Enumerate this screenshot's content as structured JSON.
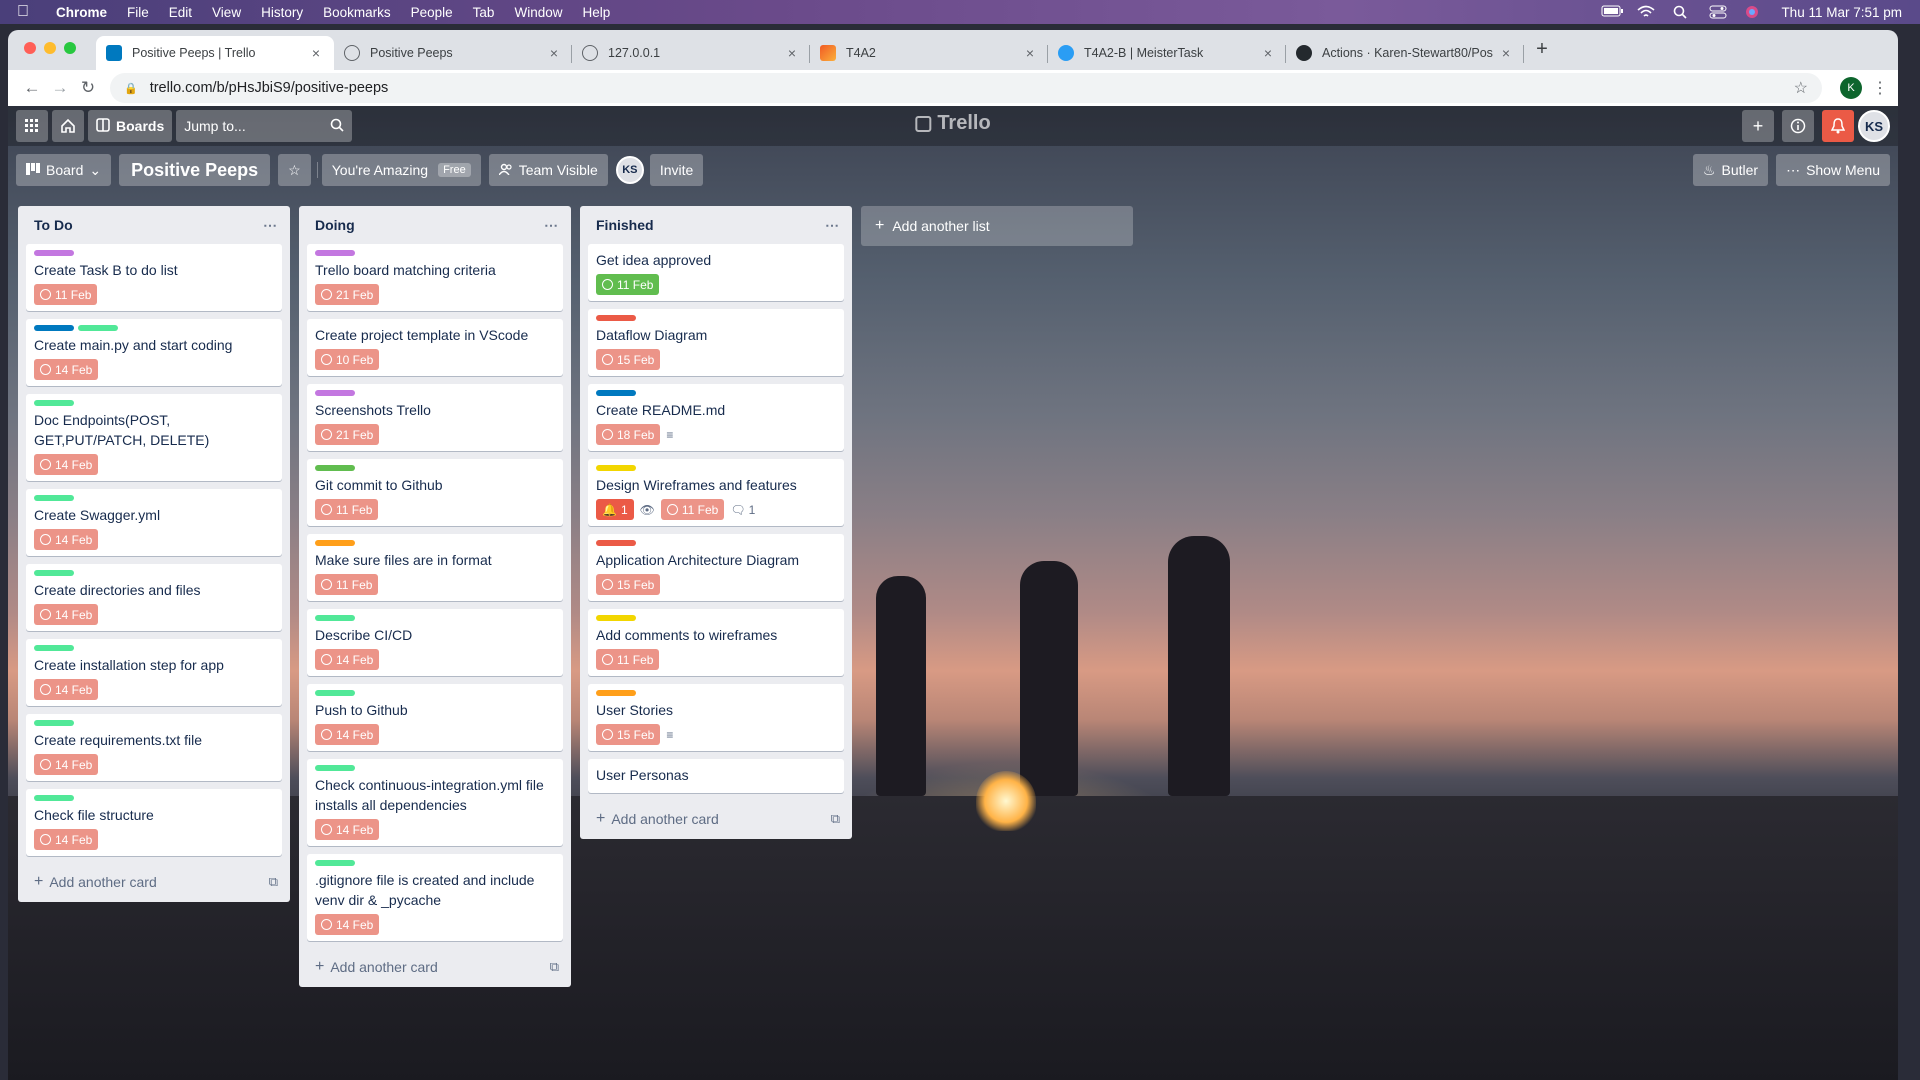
{
  "os_menubar": {
    "app": "Chrome",
    "items": [
      "File",
      "Edit",
      "View",
      "History",
      "Bookmarks",
      "People",
      "Tab",
      "Window",
      "Help"
    ],
    "clock": "Thu 11 Mar  7:51 pm"
  },
  "browser": {
    "tabs": [
      {
        "title": "Positive Peeps | Trello",
        "favicon": "trello-icon",
        "active": true
      },
      {
        "title": "Positive Peeps",
        "favicon": "globe-icon"
      },
      {
        "title": "127.0.0.1",
        "favicon": "globe-icon"
      },
      {
        "title": "T4A2",
        "favicon": "app-icon"
      },
      {
        "title": "T4A2-B | MeisterTask",
        "favicon": "check-icon"
      },
      {
        "title": "Actions · Karen-Stewart80/Pos",
        "favicon": "github-icon"
      }
    ],
    "url": "trello.com/b/pHsJbiS9/positive-peeps",
    "profile_initial": "K"
  },
  "trello_nav": {
    "boards_label": "Boards",
    "jump_placeholder": "Jump to...",
    "logo": "Trello",
    "avatar": "KS"
  },
  "board_header": {
    "view": "Board",
    "title": "Positive Peeps",
    "team": "You're Amazing",
    "team_badge": "Free",
    "visibility": "Team Visible",
    "member": "KS",
    "invite": "Invite",
    "butler": "Butler",
    "menu": "Show Menu"
  },
  "colors": {
    "purple": "#c377e0",
    "blue": "#0079bf",
    "green": "#61bd4f",
    "lime": "#51e898",
    "red": "#eb5a46",
    "yellow": "#f2d600",
    "orange": "#ff9f1a",
    "due_overdue": "#ec9488",
    "due_complete": "#61bd4f"
  },
  "lists": [
    {
      "title": "To Do",
      "add_card": "Add another card",
      "cards": [
        {
          "labels": [
            "purple"
          ],
          "title": "Create Task B to do list",
          "due": "11 Feb"
        },
        {
          "labels": [
            "blue",
            "lime"
          ],
          "title": "Create main.py and start coding",
          "due": "14 Feb"
        },
        {
          "labels": [
            "lime"
          ],
          "title": "Doc Endpoints(POST, GET,PUT/PATCH, DELETE)",
          "due": "14 Feb"
        },
        {
          "labels": [
            "lime"
          ],
          "title": "Create Swagger.yml",
          "due": "14 Feb"
        },
        {
          "labels": [
            "lime"
          ],
          "title": "Create directories and files",
          "due": "14 Feb"
        },
        {
          "labels": [
            "lime"
          ],
          "title": "Create installation step for app",
          "due": "14 Feb"
        },
        {
          "labels": [
            "lime"
          ],
          "title": "Create requirements.txt file",
          "due": "14 Feb"
        },
        {
          "labels": [
            "lime"
          ],
          "title": "Check file structure",
          "due": "14 Feb"
        }
      ]
    },
    {
      "title": "Doing",
      "add_card": "Add another card",
      "cards": [
        {
          "labels": [
            "purple"
          ],
          "title": "Trello board matching criteria",
          "due": "21 Feb"
        },
        {
          "labels": [],
          "title": "Create project template in VScode",
          "due": "10 Feb"
        },
        {
          "labels": [
            "purple"
          ],
          "title": "Screenshots Trello",
          "due": "21 Feb"
        },
        {
          "labels": [
            "green"
          ],
          "title": "Git commit to Github",
          "due": "11 Feb"
        },
        {
          "labels": [
            "orange"
          ],
          "title": "Make sure files are in format",
          "due": "11 Feb"
        },
        {
          "labels": [
            "lime"
          ],
          "title": "Describe CI/CD",
          "due": "14 Feb"
        },
        {
          "labels": [
            "lime"
          ],
          "title": "Push to Github",
          "due": "14 Feb"
        },
        {
          "labels": [
            "lime"
          ],
          "title": "Check continuous-integration.yml file installs all dependencies",
          "due": "14 Feb"
        },
        {
          "labels": [
            "lime"
          ],
          "title": ".gitignore file is created and include venv dir & _pycache",
          "due": "14 Feb"
        }
      ]
    },
    {
      "title": "Finished",
      "add_card": "Add another card",
      "cards": [
        {
          "labels": [],
          "title": "Get idea approved",
          "due": "11 Feb",
          "due_state": "done"
        },
        {
          "labels": [
            "red"
          ],
          "title": "Dataflow Diagram",
          "due": "15 Feb"
        },
        {
          "labels": [
            "blue"
          ],
          "title": "Create README.md",
          "due": "18 Feb",
          "description": true
        },
        {
          "labels": [
            "yellow"
          ],
          "title": "Design Wireframes and features",
          "due": "11 Feb",
          "notifications": "1",
          "watching": true,
          "comments": "1"
        },
        {
          "labels": [
            "red"
          ],
          "title": "Application Architecture Diagram",
          "due": "15 Feb"
        },
        {
          "labels": [
            "yellow"
          ],
          "title": "Add comments to wireframes",
          "due": "11 Feb"
        },
        {
          "labels": [
            "orange"
          ],
          "title": "User Stories",
          "due": "15 Feb",
          "description": true
        },
        {
          "labels": [],
          "title": "User Personas"
        }
      ]
    }
  ],
  "add_list": "Add another list"
}
